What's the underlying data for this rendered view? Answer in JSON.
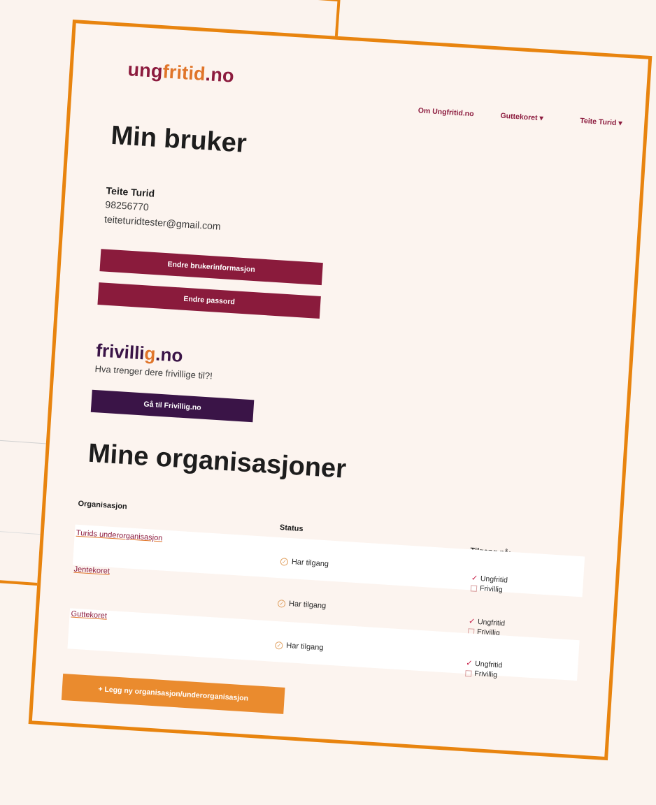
{
  "header": {
    "logo": {
      "part1": "ung",
      "part2": "fritid",
      "part3": ".no"
    },
    "nav": {
      "about": "Om Ungfritid.no",
      "org_menu": "Guttekoret ▾",
      "user_menu": "Teite Turid ▾"
    }
  },
  "profile": {
    "title": "Min bruker",
    "name": "Teite Turid",
    "phone": "98256770",
    "email": "teiteturidtester@gmail.com",
    "edit_info_button": "Endre brukerinformasjon",
    "change_password_button": "Endre passord"
  },
  "frivillig": {
    "logo": {
      "part1": "frivilli",
      "part2": "g",
      "part3": ".no"
    },
    "tagline": "Hva trenger dere frivillige til?!",
    "goto_button": "Gå til Frivillig.no"
  },
  "organizations": {
    "title": "Mine organisasjoner",
    "columns": {
      "org": "Organisasjon",
      "status": "Status",
      "access": "Tilgang på:"
    },
    "rows": [
      {
        "name": "Turids underorganisasjon",
        "status": "Har tilgang",
        "access1": "Ungfritid",
        "access2": "Frivillig",
        "access1_checked": true,
        "access2_checked": false
      },
      {
        "name": "Jentekoret",
        "status": "Har tilgang",
        "access1": "Ungfritid",
        "access2": "Frivillig",
        "access1_checked": true,
        "access2_checked": false
      },
      {
        "name": "Guttekoret",
        "status": "Har tilgang",
        "access1": "Ungfritid",
        "access2": "Frivillig",
        "access1_checked": true,
        "access2_checked": false
      }
    ],
    "add_button": "+ Legg ny organisasjon/underorganisasjon"
  },
  "colors": {
    "frame": "#e8840f",
    "primary": "#8a1b3c",
    "frivillig": "#3a1447",
    "accent": "#ea8b2e"
  }
}
